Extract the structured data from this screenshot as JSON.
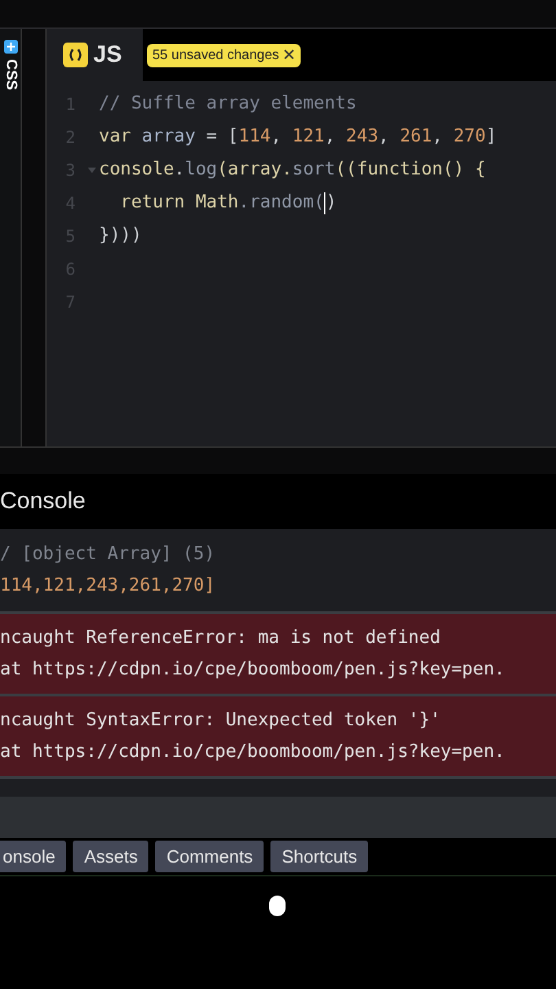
{
  "sidebar": {
    "label": "CSS"
  },
  "editor": {
    "tab": {
      "label": "JS"
    },
    "badge": {
      "text": "55 unsaved changes",
      "close": "✕"
    },
    "lines": [
      {
        "number": "1",
        "tokens": [
          {
            "text": "// Suffle array elements",
            "kind": "comment"
          }
        ]
      },
      {
        "number": "2",
        "tokens": [
          {
            "text": "var",
            "kind": "keyword"
          },
          {
            "text": " array ",
            "kind": "ident"
          },
          {
            "text": "= [",
            "kind": "punct"
          },
          {
            "text": "114",
            "kind": "number"
          },
          {
            "text": ", ",
            "kind": "punct"
          },
          {
            "text": "121",
            "kind": "number"
          },
          {
            "text": ", ",
            "kind": "punct"
          },
          {
            "text": "243",
            "kind": "number"
          },
          {
            "text": ", ",
            "kind": "punct"
          },
          {
            "text": "261",
            "kind": "number"
          },
          {
            "text": ", ",
            "kind": "punct"
          },
          {
            "text": "270",
            "kind": "number"
          },
          {
            "text": "]",
            "kind": "punct"
          }
        ]
      },
      {
        "number": "3",
        "fold": true,
        "tokens": [
          {
            "text": "console",
            "kind": "keyword"
          },
          {
            "text": ".",
            "kind": "punct"
          },
          {
            "text": "log",
            "kind": "method"
          },
          {
            "text": "(array.",
            "kind": "keyword"
          },
          {
            "text": "sort",
            "kind": "method"
          },
          {
            "text": "((function() {",
            "kind": "keyword"
          }
        ]
      },
      {
        "number": "4",
        "tokens": [
          {
            "text": "  return Math",
            "kind": "keyword"
          },
          {
            "text": ".random(",
            "kind": "method"
          },
          {
            "kind": "cursor"
          },
          {
            "text": ")",
            "kind": "punct"
          }
        ]
      },
      {
        "number": "5",
        "tokens": [
          {
            "text": "})))",
            "kind": "punct"
          }
        ]
      },
      {
        "number": "6"
      },
      {
        "number": "7"
      }
    ]
  },
  "console": {
    "title": "Console",
    "entries": [
      {
        "kind": "log",
        "lines": [
          {
            "text": "/ [object Array] (5)",
            "kind": "meta"
          },
          {
            "text": "114,121,243,261,270]",
            "kind": "value"
          }
        ]
      },
      {
        "kind": "error",
        "lines": [
          {
            "text": "ncaught ReferenceError: ma is not defined",
            "kind": "message"
          },
          {
            "text": "at https://cdpn.io/cpe/boomboom/pen.js?key=pen.",
            "kind": "message"
          }
        ]
      },
      {
        "kind": "error",
        "lines": [
          {
            "text": "ncaught SyntaxError: Unexpected token '}'",
            "kind": "message"
          },
          {
            "text": "at https://cdpn.io/cpe/boomboom/pen.js?key=pen.",
            "kind": "message"
          }
        ]
      }
    ]
  },
  "bottom_tabs": [
    {
      "label": "onsole"
    },
    {
      "label": "Assets"
    },
    {
      "label": "Comments"
    },
    {
      "label": "Shortcuts"
    }
  ]
}
